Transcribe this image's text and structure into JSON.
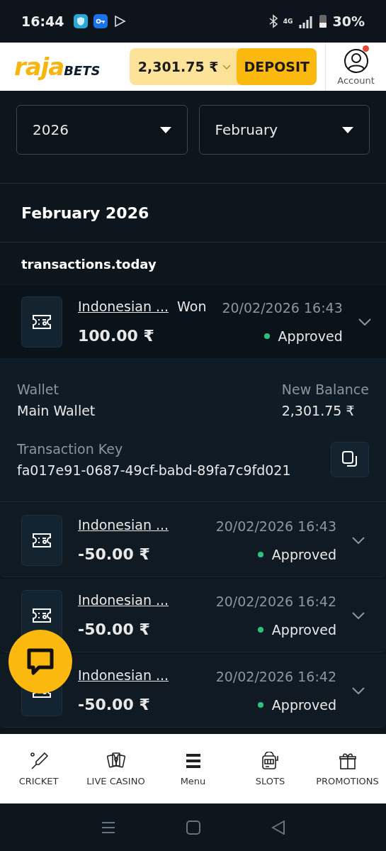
{
  "status_bar": {
    "time": "16:44",
    "battery": "30%",
    "network": "4G"
  },
  "header": {
    "logo_main": "raja",
    "logo_sub": "BETS",
    "balance": "2,301.75 ₹",
    "deposit": "DEPOSIT",
    "account": "Account",
    "account_alert": true
  },
  "filters": [
    {
      "value": "2026"
    },
    {
      "value": "February"
    }
  ],
  "period_title": "February 2026",
  "group_title": "transactions.today",
  "transactions": [
    {
      "game": "Indonesian ...",
      "result": "Won",
      "date": "20/02/2026 16:43",
      "amount": "100.00 ₹",
      "status": "Approved",
      "color": "#2fbf7f",
      "expanded": true,
      "details": {
        "wallet_label": "Wallet",
        "wallet": "Main Wallet",
        "balance_label": "New Balance",
        "balance": "2,301.75 ₹",
        "key_label": "Transaction Key",
        "key": "fa017e91-0687-49cf-babd-89fa7c9fd021"
      }
    },
    {
      "game": "Indonesian ...",
      "date": "20/02/2026 16:43",
      "amount": "-50.00 ₹",
      "status": "Approved",
      "color": "#2fbf7f",
      "expanded": false
    },
    {
      "game": "Indonesian ...",
      "date": "20/02/2026 16:42",
      "amount": "-50.00 ₹",
      "status": "Approved",
      "color": "#2fbf7f",
      "expanded": false
    },
    {
      "game": "Indonesian ...",
      "date": "20/02/2026 16:42",
      "amount": "-50.00 ₹",
      "status": "Approved",
      "color": "#2fbf7f",
      "expanded": false
    }
  ],
  "bottom_nav": [
    {
      "label": "CRICKET",
      "kind": "cricket"
    },
    {
      "label": "LIVE CASINO",
      "kind": "cards"
    },
    {
      "label": "Menu",
      "kind": "menu"
    },
    {
      "label": "SLOTS",
      "kind": "slots"
    },
    {
      "label": "PROMOTIONS",
      "kind": "gift"
    }
  ]
}
